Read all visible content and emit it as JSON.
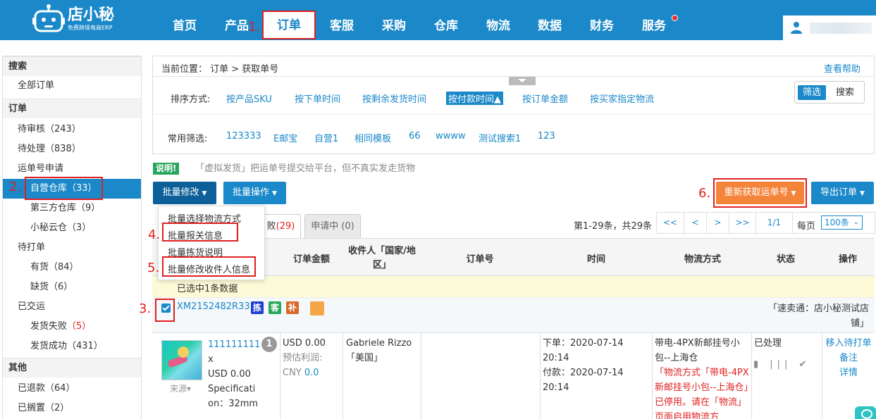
{
  "header": {
    "logo_name": "店小秘",
    "logo_slogan": "免费跨境电商ERP",
    "nav": [
      "首页",
      "产品",
      "订单",
      "客服",
      "采购",
      "仓库",
      "物流",
      "数据",
      "财务",
      "服务"
    ],
    "active_nav": "订单"
  },
  "annotations": [
    "1.",
    "2.",
    "3.",
    "4.",
    "5.",
    "6."
  ],
  "sidebar": {
    "sections": [
      {
        "label": "搜索",
        "type": "head"
      },
      {
        "label": "全部订单",
        "type": "l1"
      },
      {
        "label": "订单",
        "type": "head"
      },
      {
        "label": "待审核",
        "count": "（243）",
        "type": "l1"
      },
      {
        "label": "待处理",
        "count": "（838）",
        "type": "l1"
      },
      {
        "label": "运单号申请",
        "type": "l1"
      },
      {
        "label": "自营仓库",
        "count": "（33）",
        "type": "l2",
        "active": true
      },
      {
        "label": "第三方仓库",
        "count": "（9）",
        "type": "l2"
      },
      {
        "label": "小秘云仓",
        "count": "（3）",
        "type": "l2"
      },
      {
        "label": "待打单",
        "type": "l1"
      },
      {
        "label": "有货",
        "count": "（84）",
        "type": "l2"
      },
      {
        "label": "缺货",
        "count": "（6）",
        "type": "l2"
      },
      {
        "label": "已交运",
        "type": "l1"
      },
      {
        "label": "发货失败",
        "count": "（5）",
        "type": "l2",
        "red": true
      },
      {
        "label": "发货成功",
        "count": "（431）",
        "type": "l2"
      },
      {
        "label": "其他",
        "type": "head"
      },
      {
        "label": "已退款",
        "count": "（64）",
        "type": "l1"
      },
      {
        "label": "已搁置",
        "count": "（2）",
        "type": "l1"
      }
    ]
  },
  "panel": {
    "breadcrumb": "当前位置： 订单 > 获取单号",
    "help": "查看帮助",
    "sort_label": "排序方式:",
    "sort_items": [
      "按产品SKU",
      "按下单时间",
      "按剩余发货时间",
      "按付款时间▲",
      "按订单金额",
      "按买家指定物流"
    ],
    "sort_active": "按付款时间▲",
    "filter_label": "常用筛选:",
    "filter_items": [
      "123333",
      "E邮宝",
      "自营1",
      "相同模板",
      "66",
      "wwww",
      "测试搜索1",
      "123"
    ],
    "toggle_on": "筛选",
    "toggle_off": "搜索"
  },
  "note": {
    "badge": "说明!",
    "text": "「虚拟发货」把运单号提交给平台，但不真实发走货物"
  },
  "actions": {
    "batch_edit": "批量修改",
    "batch_ops": "批量操作",
    "reget": "重新获取运单号",
    "export": "导出订单"
  },
  "dropdown": [
    "批量选择物流方式",
    "批量报关信息",
    "批量拣货说明",
    "批量修改收件人信息"
  ],
  "tabs": {
    "failed_suffix": "败",
    "failed_count": "(29)",
    "pending": "申请中 (0)"
  },
  "pager": {
    "info": "第1-29条，共29条",
    "buttons": [
      "<<",
      "<",
      ">",
      ">>",
      "1/1"
    ],
    "perpage_label": "每页",
    "perpage_value": "100条"
  },
  "table": {
    "headers": [
      "订单金额",
      "收件人「国家/地区」",
      "订单号",
      "时间",
      "物流方式",
      "状态",
      "操作"
    ],
    "selected_info": "已选中1条数据"
  },
  "order": {
    "order_no": "XM2152482R33",
    "tags": [
      {
        "text": "拣",
        "color": "#1f3fd1"
      },
      {
        "text": "客",
        "color": "#2aa85a"
      },
      {
        "text": "补",
        "color": "#d9682b"
      },
      {
        "text": "",
        "color": "#f5a647"
      }
    ],
    "shop": "「速卖通：店小秘测试店铺」",
    "product_link": "111111111",
    "product_mult": "x",
    "product_price": "USD 0.00",
    "product_spec": "Specification：32mm",
    "quantity": "1",
    "source": "来源▾",
    "amount": "USD 0.00",
    "profit_label": "预估利润:",
    "profit_currency": "CNY",
    "profit_value": "0.0",
    "recipient": "Gabriele Rizzo",
    "country": "「美国」",
    "order_time": "下单：2020-07-14 20:14",
    "pay_time": "付款：2020-07-14 20:14",
    "logistics": "带电-4PX新邮挂号小包--上海仓",
    "logistics_warning": "「物流方式「带电-4PX新邮挂号小包--上海仓」已停用。请在「物流」页面启用物流方",
    "status": "已处理",
    "op_icons": "▮ ||| ✔",
    "actions": [
      "移入待打单",
      "备注",
      "详情"
    ]
  }
}
